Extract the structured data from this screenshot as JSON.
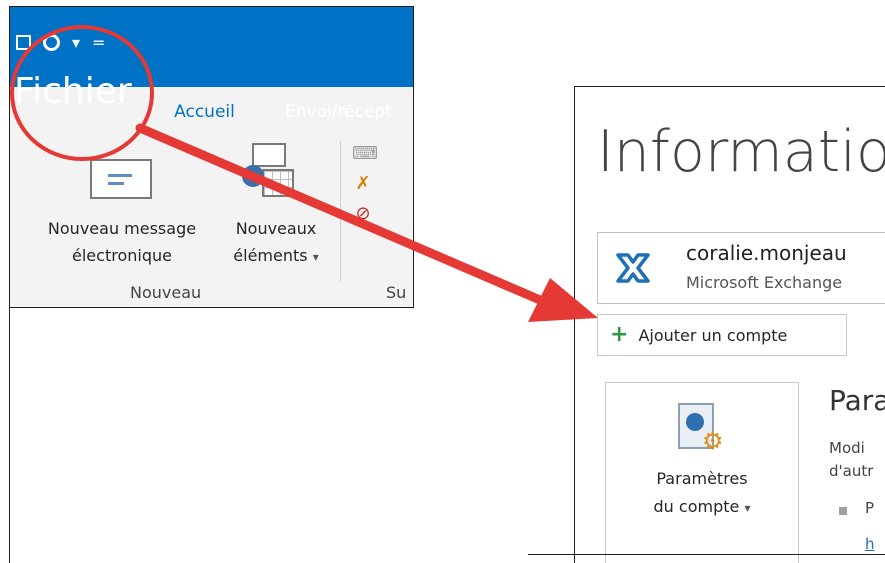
{
  "ribbon": {
    "tabs": {
      "file": "Fichier",
      "home": "Accueil",
      "send_receive": "Envoi/récept"
    },
    "new_email": {
      "line1": "Nouveau message",
      "line2": "électronique"
    },
    "new_items": {
      "line1": "Nouveaux",
      "line2": "éléments",
      "dropdown_glyph": "▾"
    },
    "groups": {
      "new": "Nouveau",
      "delete_partial": "Su"
    },
    "qat_dropdown_glyph": "▾",
    "qat_customize_glyph": "="
  },
  "backstage": {
    "title": "Informatio",
    "account": {
      "email": "coralie.monjeau",
      "type": "Microsoft Exchange"
    },
    "add_account": {
      "icon": "plus-icon",
      "label": "Ajouter un compte"
    },
    "account_settings": {
      "line1": "Paramètres",
      "line2": "du compte",
      "dropdown_glyph": "▾"
    },
    "section_heading": "Para",
    "section_desc_line1": "Modi",
    "section_desc_line2": "d'autr",
    "bullet_text": "P",
    "link_text": "h"
  },
  "colors": {
    "outlook_blue": "#0072c6",
    "annotation_red": "#e53935",
    "plus_green": "#2e9a45"
  }
}
